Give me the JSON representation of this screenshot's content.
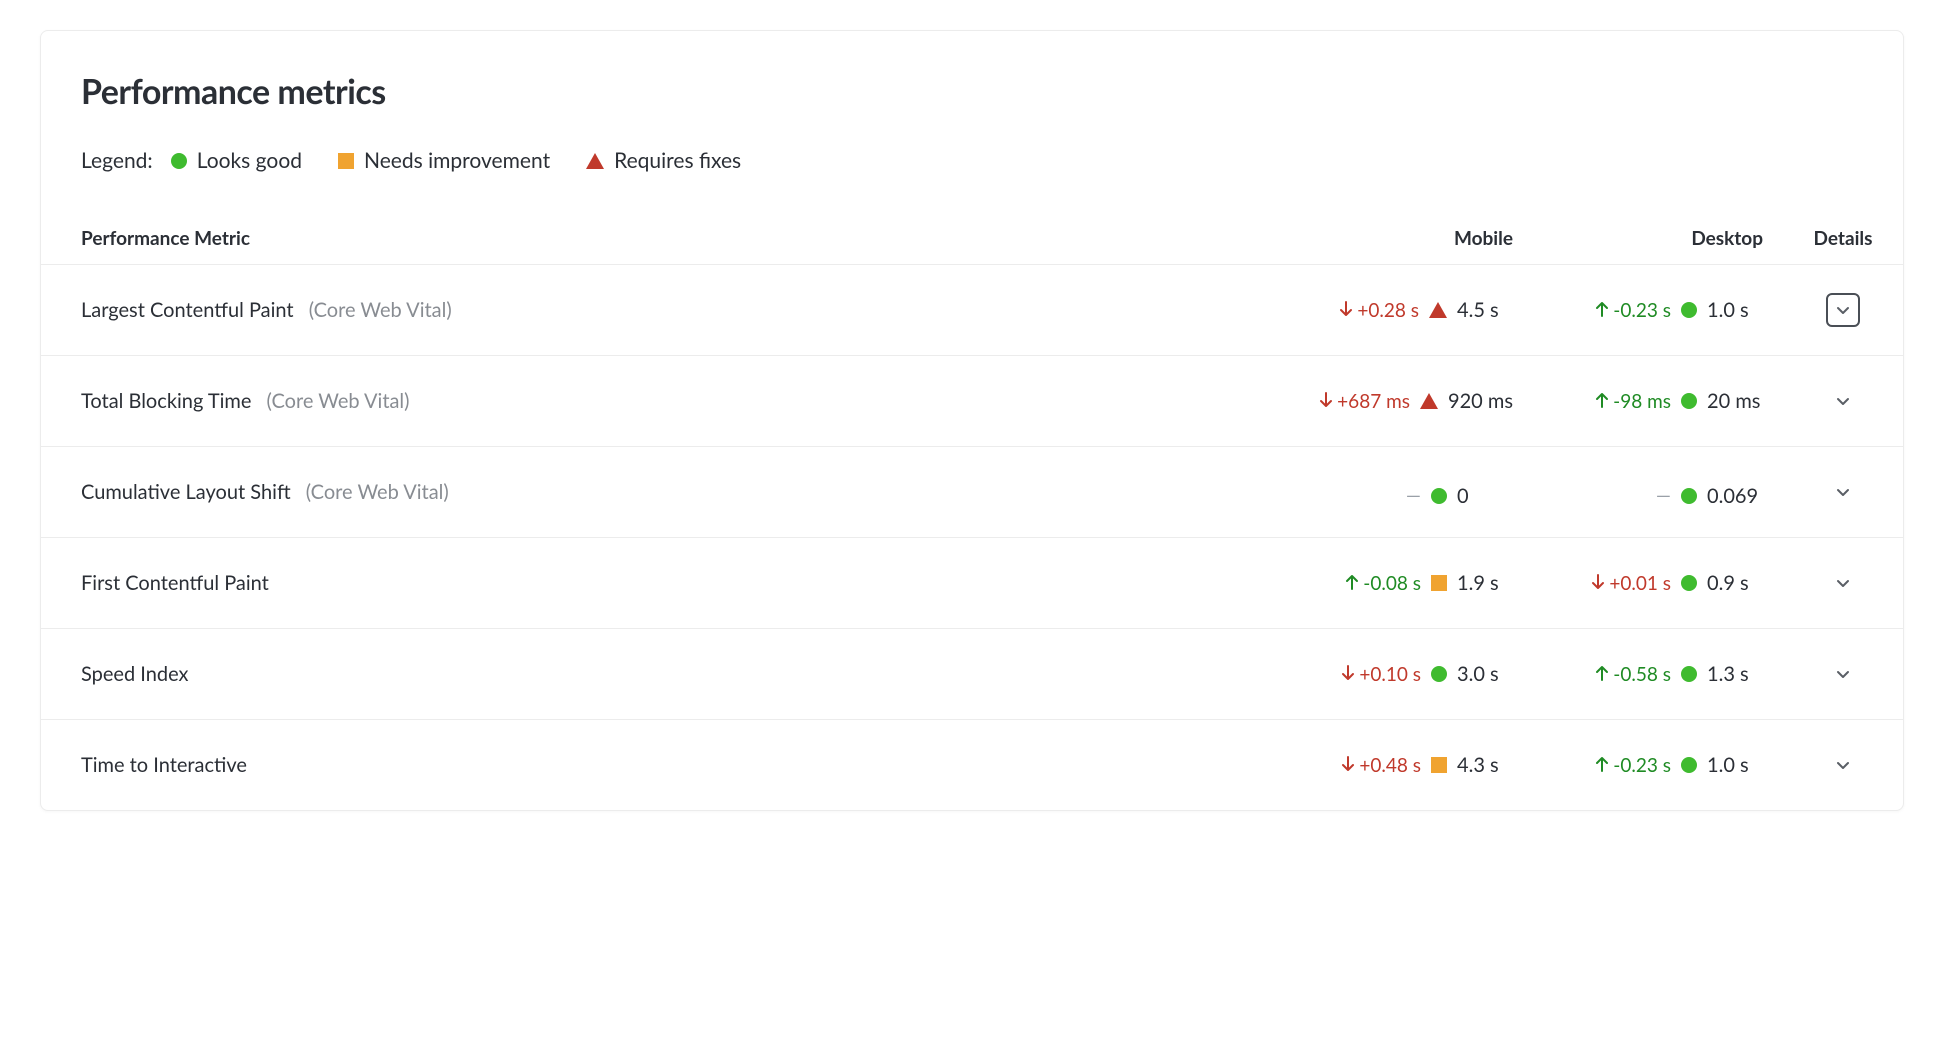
{
  "title": "Performance metrics",
  "legend": {
    "label": "Legend:",
    "good": "Looks good",
    "improve": "Needs improvement",
    "fixes": "Requires fixes"
  },
  "columns": {
    "name": "Performance Metric",
    "mobile": "Mobile",
    "desktop": "Desktop",
    "details": "Details"
  },
  "core_web_vital_label": "(Core Web Vital)",
  "rows": [
    {
      "name": "Largest Contentful Paint",
      "core": true,
      "mobile": {
        "delta_dir": "down",
        "delta": "+0.28 s",
        "status": "fixes",
        "value": "4.5 s"
      },
      "desktop": {
        "delta_dir": "up",
        "delta": "-0.23 s",
        "status": "good",
        "value": "1.0 s"
      },
      "focused": true
    },
    {
      "name": "Total Blocking Time",
      "core": true,
      "mobile": {
        "delta_dir": "down",
        "delta": "+687 ms",
        "status": "fixes",
        "value": "920 ms"
      },
      "desktop": {
        "delta_dir": "up",
        "delta": "-98 ms",
        "status": "good",
        "value": "20 ms"
      },
      "focused": false
    },
    {
      "name": "Cumulative Layout Shift",
      "core": true,
      "mobile": {
        "delta_dir": "none",
        "delta": "—",
        "status": "good",
        "value": "0"
      },
      "desktop": {
        "delta_dir": "none",
        "delta": "—",
        "status": "good",
        "value": "0.069"
      },
      "focused": false
    },
    {
      "name": "First Contentful Paint",
      "core": false,
      "mobile": {
        "delta_dir": "up",
        "delta": "-0.08 s",
        "status": "improve",
        "value": "1.9 s"
      },
      "desktop": {
        "delta_dir": "down",
        "delta": "+0.01 s",
        "status": "good",
        "value": "0.9 s"
      },
      "focused": false
    },
    {
      "name": "Speed Index",
      "core": false,
      "mobile": {
        "delta_dir": "down",
        "delta": "+0.10 s",
        "status": "good",
        "value": "3.0 s"
      },
      "desktop": {
        "delta_dir": "up",
        "delta": "-0.58 s",
        "status": "good",
        "value": "1.3 s"
      },
      "focused": false
    },
    {
      "name": "Time to Interactive",
      "core": false,
      "mobile": {
        "delta_dir": "down",
        "delta": "+0.48 s",
        "status": "improve",
        "value": "4.3 s"
      },
      "desktop": {
        "delta_dir": "up",
        "delta": "-0.23 s",
        "status": "good",
        "value": "1.0 s"
      },
      "focused": false
    }
  ]
}
